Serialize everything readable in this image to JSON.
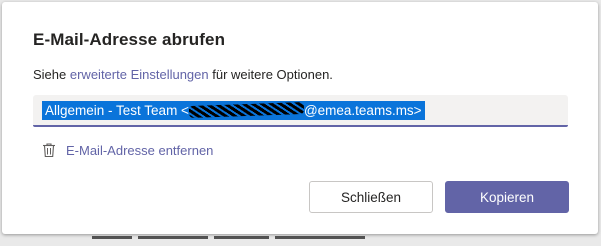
{
  "dialog": {
    "title": "E-Mail-Adresse abrufen",
    "description_prefix": "Siehe ",
    "description_link": "erweiterte Einstellungen",
    "description_suffix": " für weitere Optionen.",
    "email_prefix": "Allgemein - Test Team <",
    "email_suffix": "@emea.teams.ms>",
    "remove_label": "E-Mail-Adresse entfernen",
    "close_label": "Schließen",
    "copy_label": "Kopieren"
  },
  "icons": {
    "remove": "trash-icon"
  },
  "colors": {
    "accent": "#6264a7",
    "selection": "#0a74da",
    "field_background": "#f3f2f1"
  }
}
